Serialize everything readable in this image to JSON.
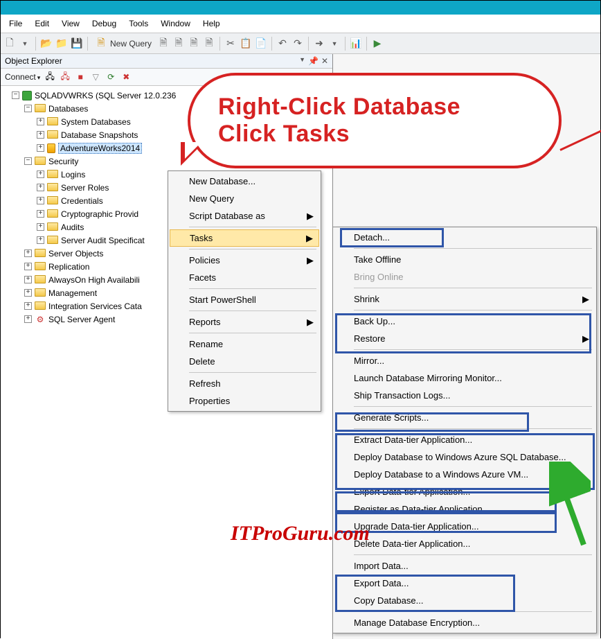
{
  "menu": {
    "file": "File",
    "edit": "Edit",
    "view": "View",
    "debug": "Debug",
    "tools": "Tools",
    "window": "Window",
    "help": "Help"
  },
  "toolbar": {
    "newquery": "New Query"
  },
  "panel": {
    "title": "Object Explorer",
    "connect": "Connect"
  },
  "tree": {
    "server": "SQLADVWRKS (SQL Server 12.0.236",
    "databases": "Databases",
    "sysdbs": "System Databases",
    "snapshots": "Database Snapshots",
    "aw": "AdventureWorks2014",
    "security": "Security",
    "logins": "Logins",
    "sroles": "Server Roles",
    "creds": "Credentials",
    "crypto": "Cryptographic Provid",
    "audits": "Audits",
    "sas": "Server Audit Specificat",
    "serverobjects": "Server Objects",
    "replication": "Replication",
    "ag": "AlwaysOn High Availabili",
    "mgmt": "Management",
    "isc": "Integration Services Cata",
    "agent": "SQL Server Agent"
  },
  "ctx1": {
    "newdb": "New Database...",
    "newq": "New Query",
    "scr": "Script Database as",
    "tasks": "Tasks",
    "pol": "Policies",
    "fac": "Facets",
    "ps": "Start PowerShell",
    "rep": "Reports",
    "ren": "Rename",
    "del": "Delete",
    "ref": "Refresh",
    "prop": "Properties"
  },
  "ctx2": {
    "det": "Detach...",
    "off": "Take Offline",
    "on": "Bring Online",
    "shr": "Shrink",
    "bu": "Back Up...",
    "rst": "Restore",
    "mir": "Mirror...",
    "ldm": "Launch Database Mirroring Monitor...",
    "stl": "Ship Transaction Logs...",
    "gen": "Generate Scripts...",
    "ext": "Extract Data-tier Application...",
    "dep1": "Deploy Database to Windows Azure SQL Database...",
    "dep2": "Deploy Database to a Windows Azure VM...",
    "exp": "Export Data-tier Application...",
    "reg": "Register as Data-tier Application...",
    "upg": "Upgrade Data-tier Application...",
    "deld": "Delete Data-tier Application...",
    "imp": "Import Data...",
    "expd": "Export Data...",
    "cpy": "Copy Database...",
    "enc": "Manage Database Encryption..."
  },
  "bubble": {
    "l1": "Right-Click Database",
    "l2": "Click Tasks"
  },
  "watermark": "ITProGuru.com"
}
